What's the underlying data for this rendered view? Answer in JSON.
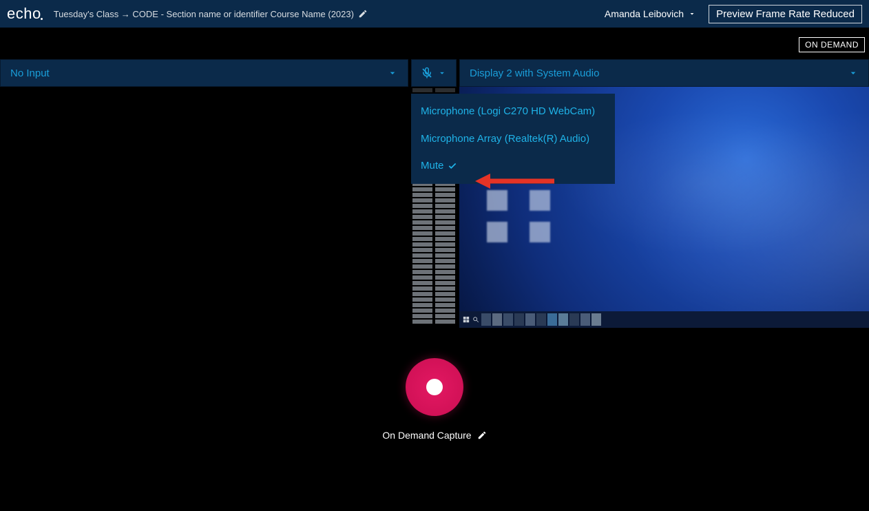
{
  "logo": "echo",
  "breadcrumb": "Tuesday's Class → CODE - Section name or identifier Course Name (2023)",
  "user_name": "Amanda Leibovich",
  "frame_rate_notice": "Preview Frame Rate Reduced",
  "status_badge": "ON DEMAND",
  "left_source": "No Input",
  "right_source": "Display 2 with System Audio",
  "mic_menu": {
    "item1": "Microphone (Logi C270 HD WebCam)",
    "item2": "Microphone Array (Realtek(R) Audio)",
    "item3": "Mute"
  },
  "capture_label": "On Demand Capture",
  "colors": {
    "accent": "#1a9ed9",
    "record": "#e31862",
    "header_bg": "#0b2a4a"
  }
}
